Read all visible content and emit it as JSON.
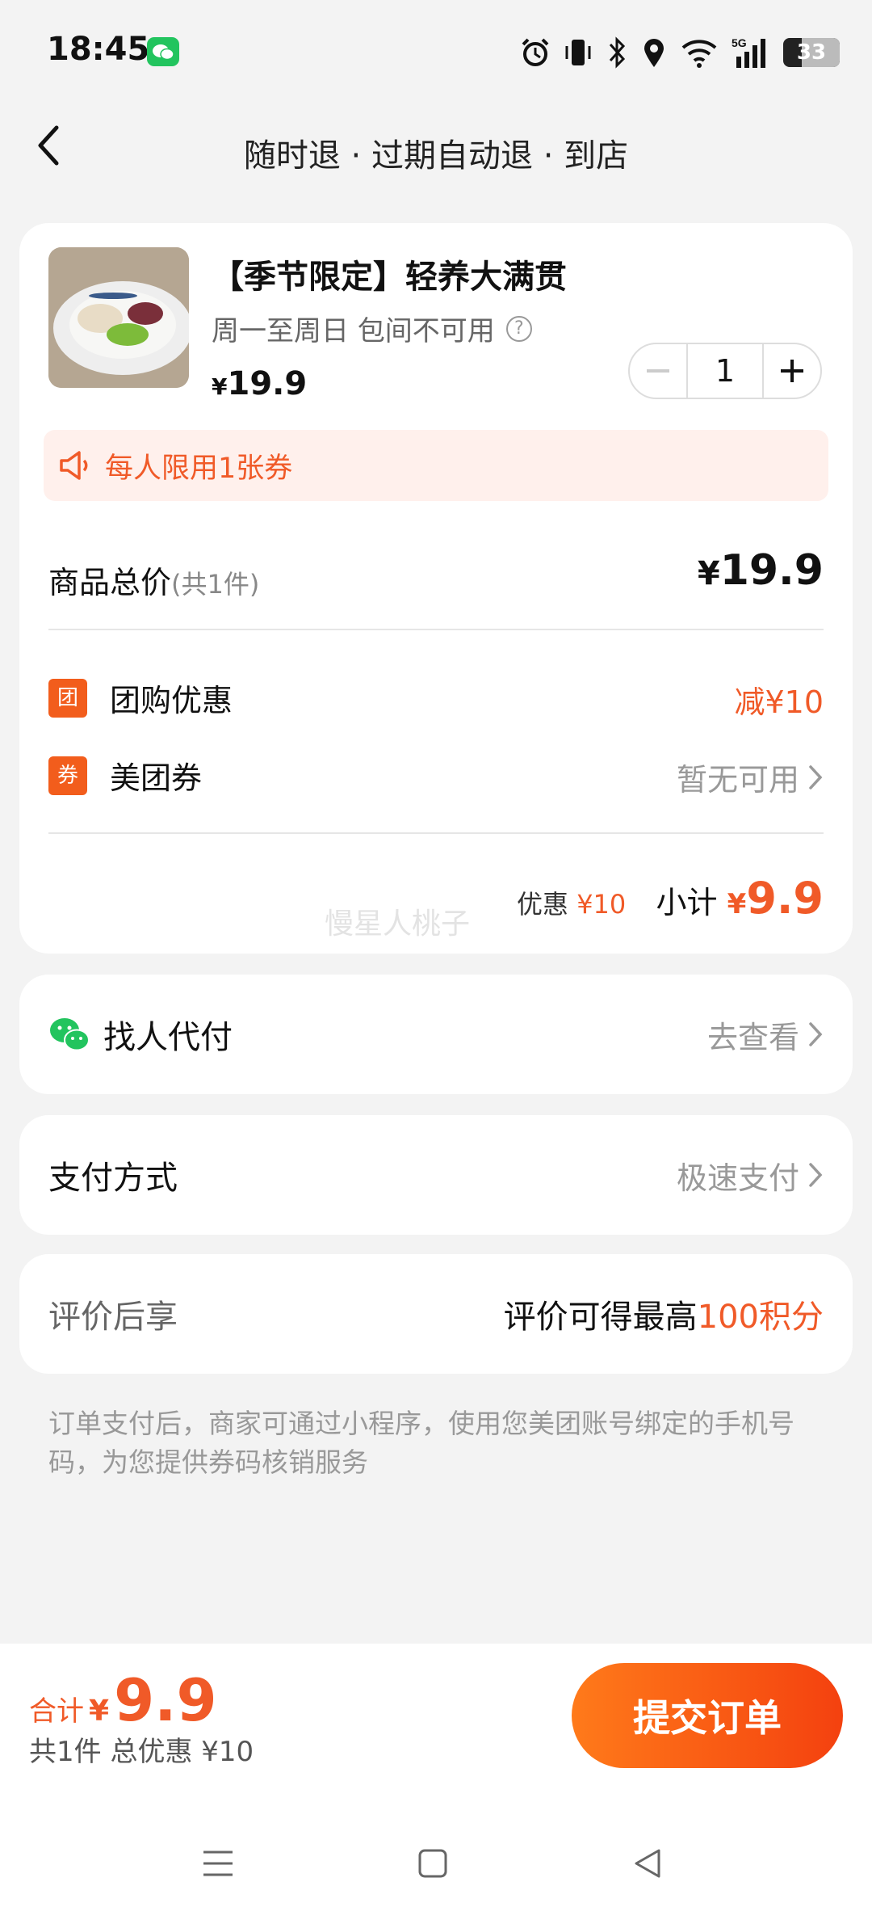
{
  "status": {
    "time": "18:45",
    "battery": "33",
    "network": "5G"
  },
  "header": {
    "title": "随时退 · 过期自动退 · 到店"
  },
  "product": {
    "name": "【季节限定】轻养大满贯",
    "subtitle": "周一至周日 包间不可用",
    "price_symbol": "¥",
    "price": "19.9",
    "quantity": "1",
    "limit_notice": "每人限用1张券"
  },
  "summary": {
    "total_label": "商品总价",
    "total_count": "(共1件)",
    "total_symbol": "¥",
    "total_value": "19.9",
    "group_discount_tag": "团",
    "group_discount_label": "团购优惠",
    "group_discount_value": "减¥10",
    "coupon_tag": "券",
    "coupon_label": "美团券",
    "coupon_value": "暂无可用",
    "discount_label": "优惠",
    "discount_value": "¥10",
    "subtotal_label": "小计",
    "subtotal_symbol": "¥",
    "subtotal_value": "9.9",
    "watermark": "慢星人桃子"
  },
  "pay_for_others": {
    "label": "找人代付",
    "action": "去查看"
  },
  "payment_method": {
    "label": "支付方式",
    "value": "极速支付"
  },
  "review": {
    "label": "评价后享",
    "prefix": "评价可得最高",
    "highlight": "100积分"
  },
  "notice": "订单支付后，商家可通过小程序，使用您美团账号绑定的手机号码，为您提供券码核销服务",
  "footer": {
    "total_label": "合计",
    "total_symbol": "¥",
    "total_value": "9.9",
    "sub": "共1件  总优惠 ¥10",
    "submit_label": "提交订单"
  },
  "colors": {
    "accent": "#f05a28",
    "background": "#f3f3f3",
    "wechat_green": "#22c45e"
  },
  "icons": {
    "back": "chevron-left-icon",
    "limit": "speaker-icon",
    "chevron": "chevron-right-icon",
    "help": "question-circle-icon",
    "wechat": "wechat-icon"
  }
}
